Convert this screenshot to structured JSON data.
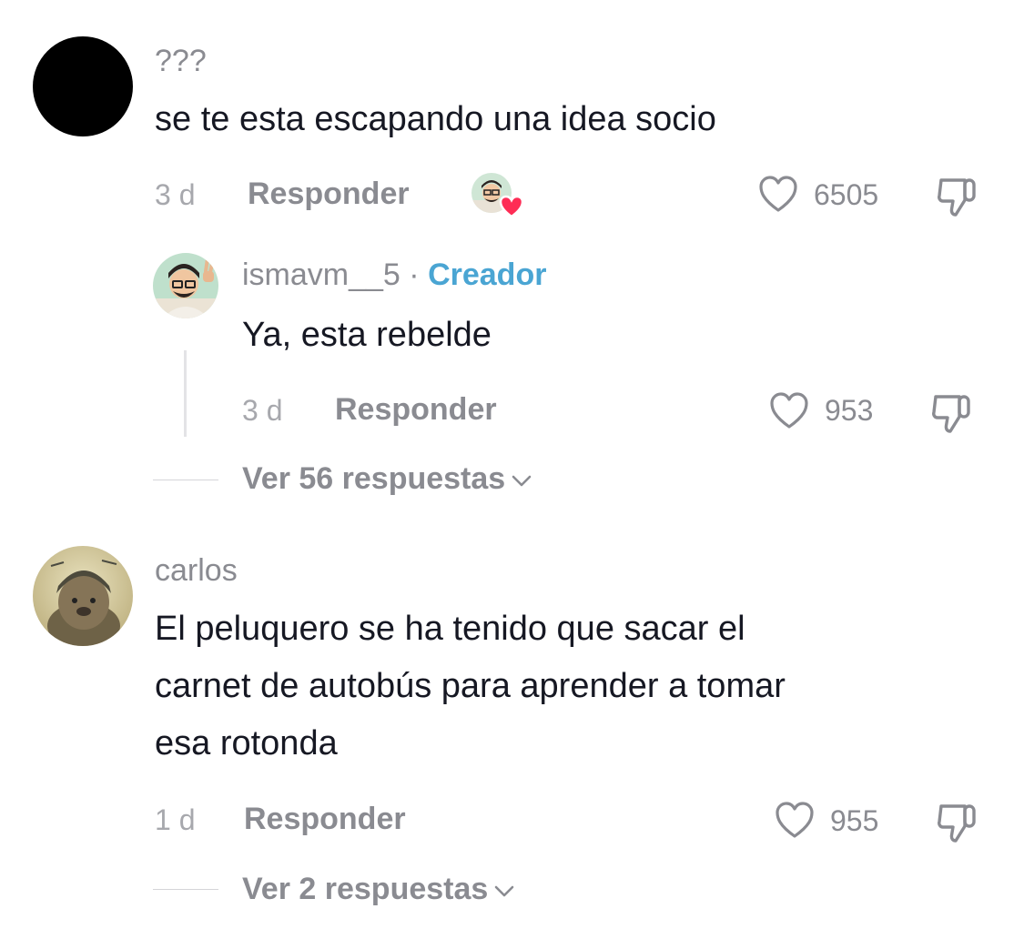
{
  "comments": [
    {
      "username": "???",
      "text": "se te esta escapando una idea socio",
      "time": "3 d",
      "reply_label": "Responder",
      "likes": "6505",
      "creator_liked": true,
      "avatar_color": "#000000",
      "replies": [
        {
          "username": "ismavm__5",
          "separator": "·",
          "badge": "Creador",
          "text": "Ya, esta rebelde",
          "time": "3 d",
          "reply_label": "Responder",
          "likes": "953"
        }
      ],
      "view_replies": "Ver 56 respuestas"
    },
    {
      "username": "carlos",
      "text_lines": [
        "El peluquero se ha tenido que sacar el",
        "carnet de autobús para aprender a tomar",
        "esa rotonda"
      ],
      "time": "1 d",
      "reply_label": "Responder",
      "likes": "955",
      "view_replies": "Ver 2 respuestas"
    }
  ],
  "icons": {
    "like": "heart-outline-icon",
    "dislike": "thumbs-down-icon",
    "expand": "chevron-down-icon",
    "creator_like": "heart-filled-icon"
  },
  "colors": {
    "creator_badge": "#4aa5d3",
    "heart_badge": "#fe2c55",
    "secondary_text": "#8a8b91"
  }
}
